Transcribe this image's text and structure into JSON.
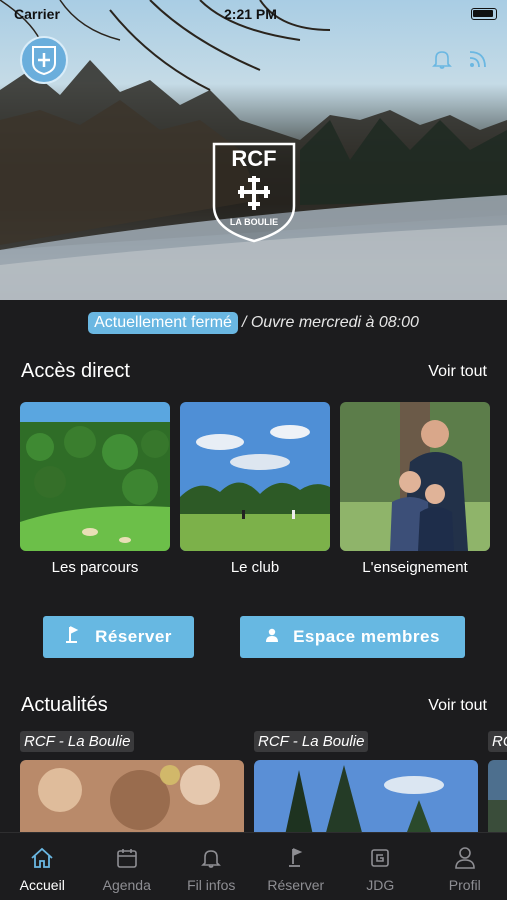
{
  "status_bar": {
    "carrier": "Carrier",
    "time": "2:21 PM"
  },
  "hero": {
    "logo_text": "RCF",
    "logo_subtitle": "LA BOULIE"
  },
  "status": {
    "closed_label": "Actuellement fermé",
    "opens_label": "/ Ouvre mercredi à 08:00"
  },
  "direct_access": {
    "title": "Accès direct",
    "see_all": "Voir tout",
    "items": [
      {
        "label": "Les parcours"
      },
      {
        "label": "Le club"
      },
      {
        "label": "L'enseignement"
      }
    ]
  },
  "actions": {
    "reserve_label": "Réserver",
    "members_label": "Espace membres"
  },
  "news": {
    "title": "Actualités",
    "see_all": "Voir tout",
    "items": [
      {
        "source": "RCF - La Boulie"
      },
      {
        "source": "RCF - La Boulie"
      },
      {
        "source": "RC"
      }
    ]
  },
  "tabs": [
    {
      "label": "Accueil",
      "icon": "home-icon",
      "active": true
    },
    {
      "label": "Agenda",
      "icon": "calendar-icon",
      "active": false
    },
    {
      "label": "Fil infos",
      "icon": "bell-icon",
      "active": false
    },
    {
      "label": "Réserver",
      "icon": "flag-icon",
      "active": false
    },
    {
      "label": "JDG",
      "icon": "jdg-icon",
      "active": false
    },
    {
      "label": "Profil",
      "icon": "profile-icon",
      "active": false
    }
  ],
  "colors": {
    "accent": "#67b8e2",
    "background": "#1c1c1e",
    "inactive_tab": "#8e8e93"
  }
}
